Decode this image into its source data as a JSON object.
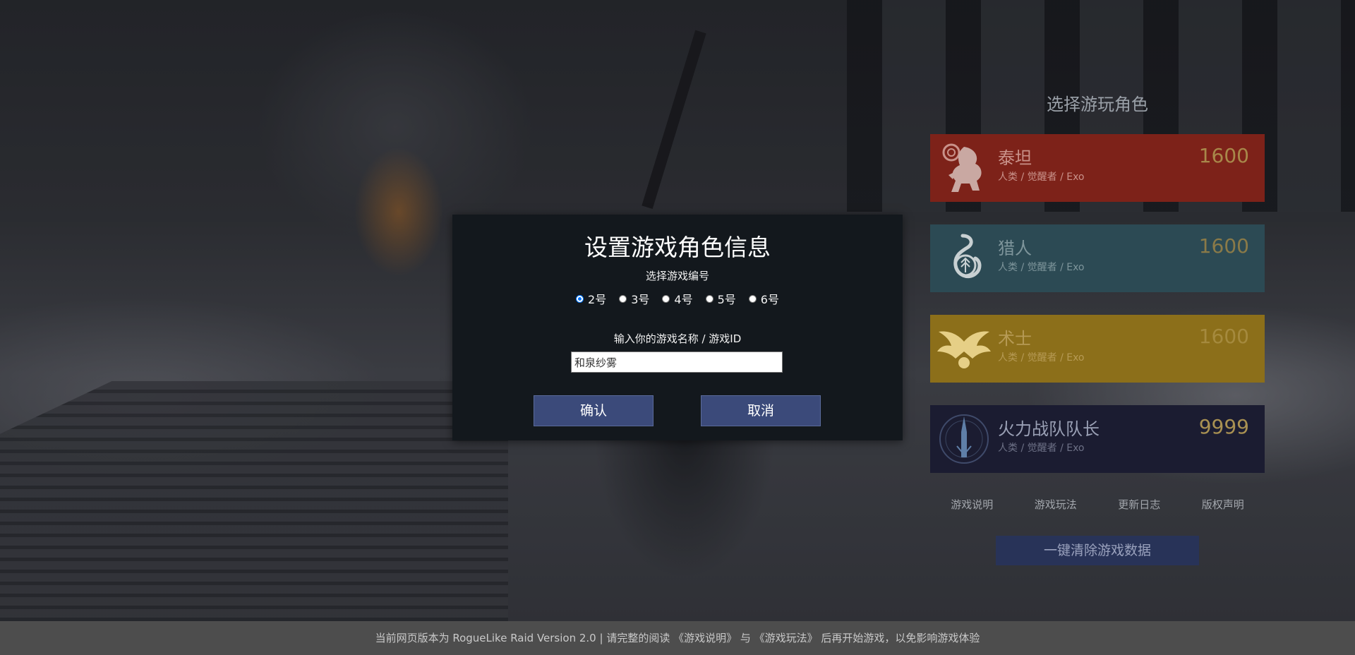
{
  "modal": {
    "title": "设置游戏角色信息",
    "slot_label": "选择游戏编号",
    "slots": [
      {
        "label": "2号",
        "checked": true
      },
      {
        "label": "3号",
        "checked": false
      },
      {
        "label": "4号",
        "checked": false
      },
      {
        "label": "5号",
        "checked": false
      },
      {
        "label": "6号",
        "checked": false
      }
    ],
    "name_label": "输入你的游戏名称 / 游戏ID",
    "name_value": "和泉纱雾",
    "confirm_label": "确认",
    "cancel_label": "取消"
  },
  "panel": {
    "title": "选择游玩角色",
    "characters": [
      {
        "name": "泰坦",
        "subtitle": "人类 / 觉醒者 / Exo",
        "score": "1600",
        "icon": "titan-emblem-icon",
        "color": "#7d2219"
      },
      {
        "name": "猎人",
        "subtitle": "人类 / 觉醒者 / Exo",
        "score": "1600",
        "icon": "hunter-emblem-icon",
        "color": "#2c4a54"
      },
      {
        "name": "术士",
        "subtitle": "人类 / 觉醒者 / Exo",
        "score": "1600",
        "icon": "warlock-emblem-icon",
        "color": "#8c6f1a"
      },
      {
        "name": "火力战队队长",
        "subtitle": "人类 / 觉醒者 / Exo",
        "score": "9999",
        "icon": "fireteam-captain-emblem-icon",
        "color": "#1b1c31"
      }
    ],
    "links": [
      "游戏说明",
      "游戏玩法",
      "更新日志",
      "版权声明"
    ],
    "clear_label": "一键清除游戏数据"
  },
  "footer": {
    "text": "当前网页版本为 RogueLike Raid Version 2.0 | 请完整的阅读 《游戏说明》 与 《游戏玩法》 后再开始游戏，以免影响游戏体验"
  }
}
